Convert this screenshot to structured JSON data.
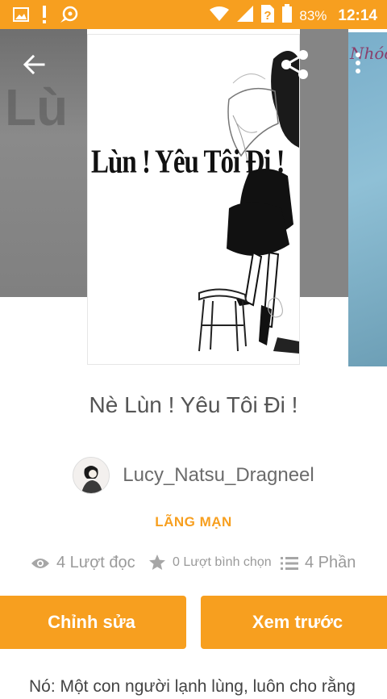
{
  "status_bar": {
    "battery": "83%",
    "time": "12:14",
    "icons": [
      "gallery-icon",
      "alert-icon",
      "bubble-icon",
      "wifi-icon",
      "signal-icon",
      "sim-question-icon",
      "battery-icon"
    ]
  },
  "toolbar": {
    "back_icon": "back-arrow-icon",
    "share_icon": "share-icon",
    "more_icon": "more-vertical-icon"
  },
  "cover": {
    "title_text": "Lùn ! Yêu Tôi Đi !",
    "right_preview_text": "Nhóc"
  },
  "story": {
    "title": "Nè Lùn ! Yêu Tôi Đi !",
    "author": "Lucy_Natsu_Dragneel",
    "genre": "LÃNG MẠN",
    "reads": "4 Lượt đọc",
    "votes": "0 Lượt bình chọn",
    "parts": "4 Phần",
    "description": "Nó: Một con người lạnh lùng, luôn cho rằng"
  },
  "buttons": {
    "edit": "Chỉnh sửa",
    "preview": "Xem trước"
  },
  "colors": {
    "accent": "#f79f1f",
    "text": "#555555",
    "muted": "#9a9a9a"
  }
}
